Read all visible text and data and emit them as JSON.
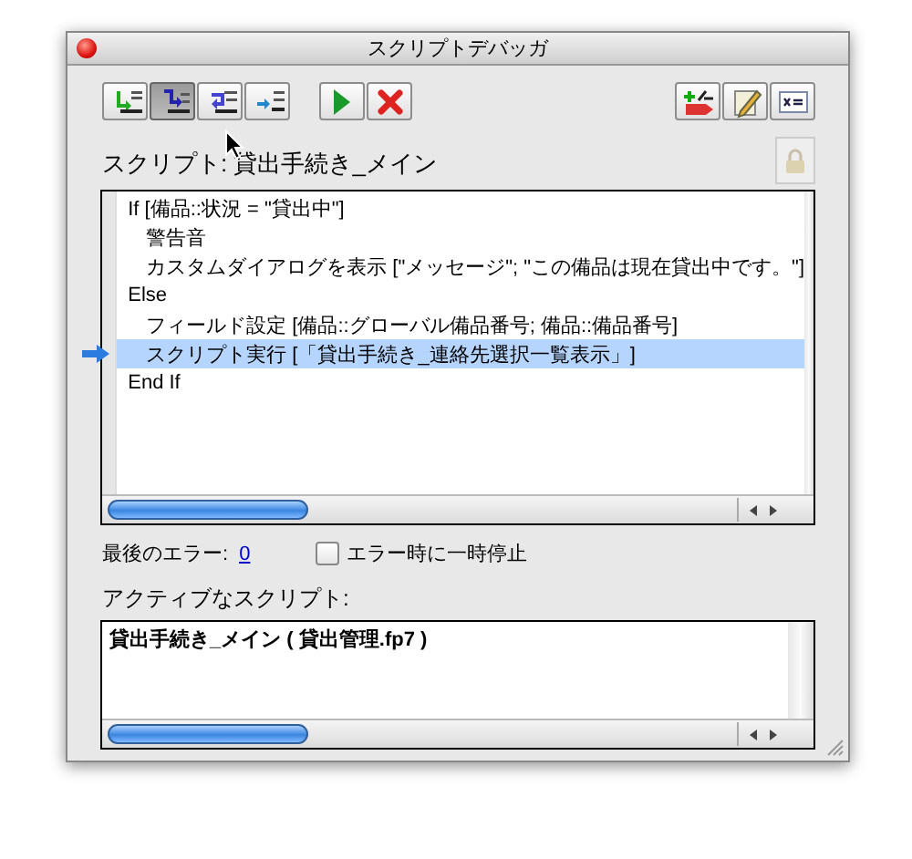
{
  "window": {
    "title": "スクリプトデバッガ"
  },
  "toolbar": {
    "buttons": [
      {
        "kind": "step",
        "pressed": false
      },
      {
        "kind": "step-into",
        "pressed": true
      },
      {
        "kind": "step-out",
        "pressed": false
      },
      {
        "kind": "set-next",
        "pressed": false
      },
      {
        "kind": "run",
        "pressed": false
      },
      {
        "kind": "halt",
        "pressed": false
      },
      {
        "kind": "breakpoint",
        "pressed": false
      },
      {
        "kind": "edit",
        "pressed": false
      },
      {
        "kind": "data-viewer",
        "pressed": false
      }
    ]
  },
  "script": {
    "label": "スクリプト: 貸出手続き_メイン",
    "steps": [
      {
        "text": "If [備品::状況 = \"貸出中\"]",
        "current": false,
        "children": [
          {
            "text": "警告音",
            "current": false
          },
          {
            "text": "カスタムダイアログを表示 [\"メッセージ\"; \"この備品は現在貸出中です。\"]",
            "current": false
          }
        ]
      },
      {
        "text": "Else",
        "current": false,
        "children": [
          {
            "text": "フィールド設定 [備品::グローバル備品番号; 備品::備品番号]",
            "current": false
          },
          {
            "text": "スクリプト実行 [「貸出手続き_連絡先選択一覧表示」]",
            "current": true
          }
        ]
      },
      {
        "text": "End If",
        "current": false
      }
    ]
  },
  "last_error": {
    "label": "最後のエラー:",
    "value": "0"
  },
  "pause_on_error": {
    "label": "エラー時に一時停止",
    "checked": false
  },
  "active_scripts": {
    "label": "アクティブなスクリプト:",
    "items": [
      {
        "text": "貸出手続き_メイン ( 貸出管理.fp7 )",
        "selected": false
      }
    ]
  }
}
